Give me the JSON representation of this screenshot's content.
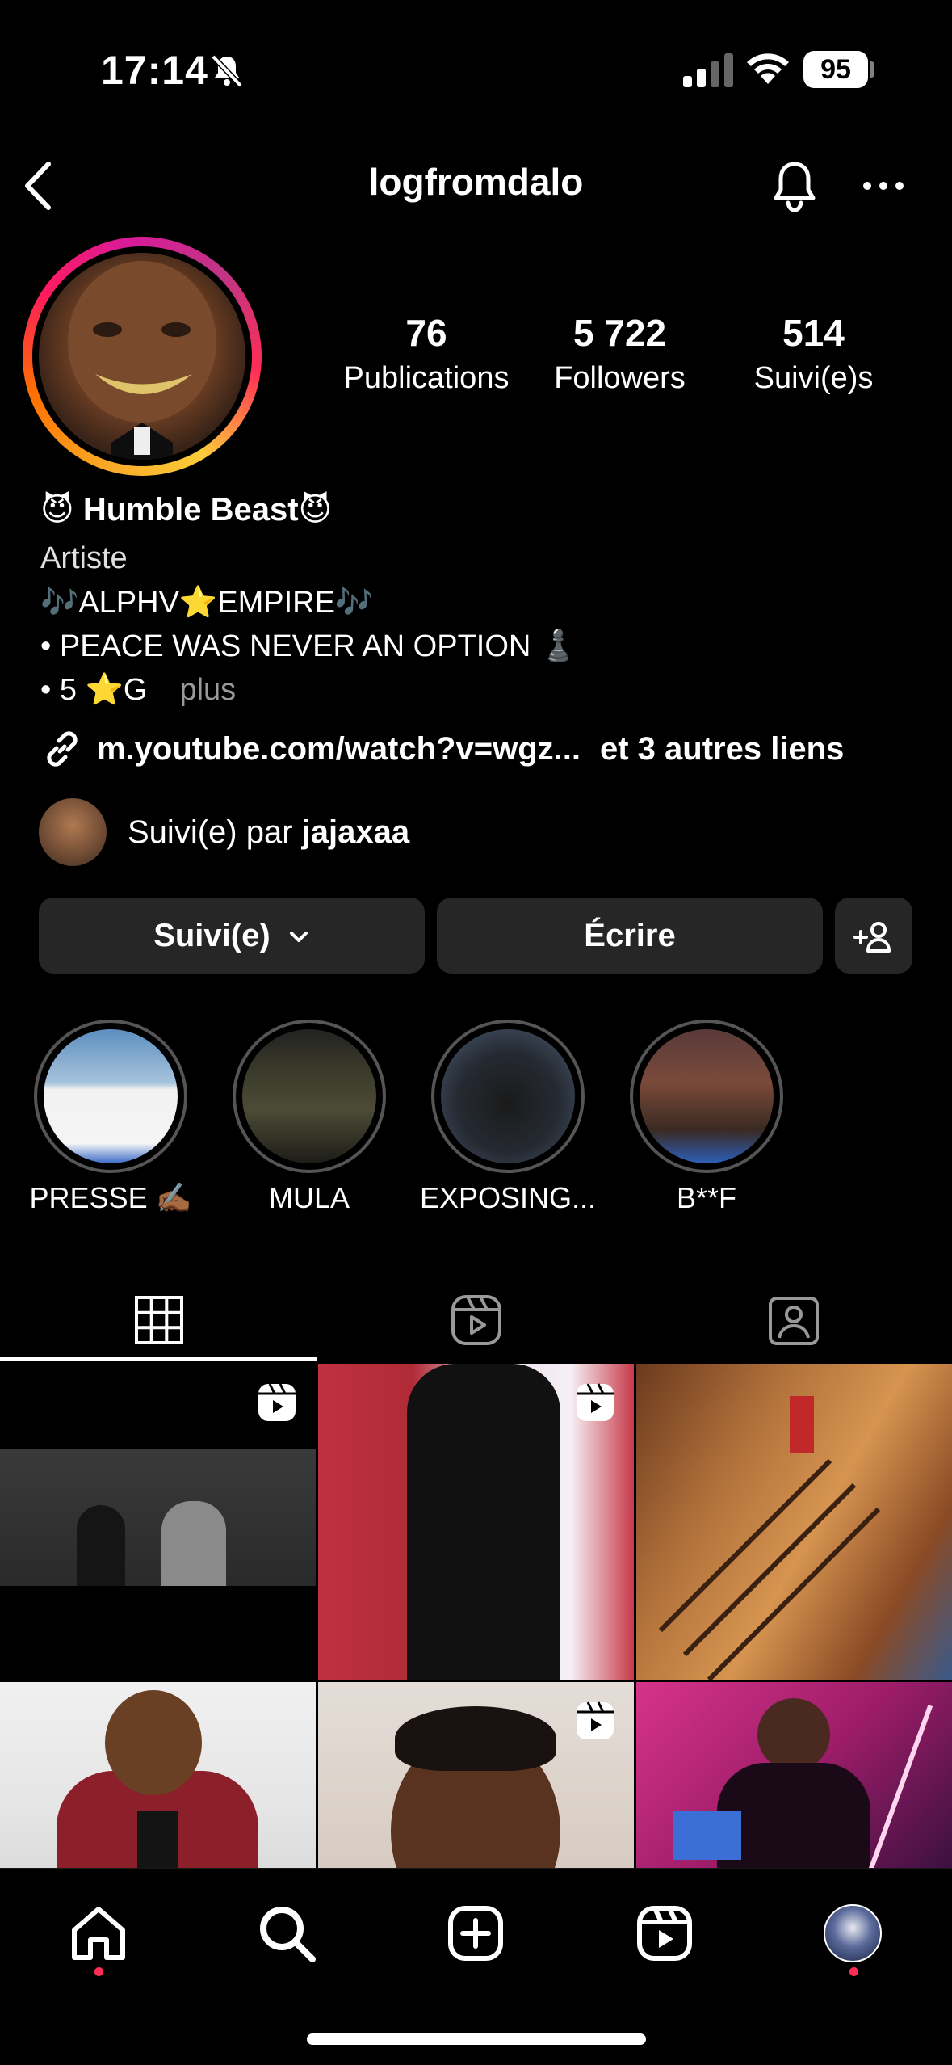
{
  "status_bar": {
    "time": "17:14",
    "battery": "95"
  },
  "header": {
    "username": "logfromdalo"
  },
  "stats": [
    {
      "value": "76",
      "label": "Publications"
    },
    {
      "value": "5 722",
      "label": "Followers"
    },
    {
      "value": "514",
      "label": "Suivi(e)s"
    }
  ],
  "bio": {
    "name": "😈 Humble Beast😈",
    "category": "Artiste",
    "lines": [
      "🎶ALPHV⭐️EMPIRE🎶",
      "• PEACE WAS NEVER AN OPTION ♟️",
      "• 5 ⭐️G"
    ],
    "more": "plus",
    "link": "m.youtube.com/watch?v=wgz...",
    "link_extra": "et 3 autres liens"
  },
  "followed_by": {
    "prefix": "Suivi(e) par ",
    "user": "jajaxaa"
  },
  "buttons": {
    "following": "Suivi(e)",
    "message": "Écrire"
  },
  "highlights": [
    {
      "label": "PRESSE ✍🏾"
    },
    {
      "label": "MULA"
    },
    {
      "label": "EXPOSING..."
    },
    {
      "label": "B**F"
    }
  ],
  "tabs": [
    {
      "icon": "grid-icon"
    },
    {
      "icon": "reels-icon"
    },
    {
      "icon": "tagged-icon"
    }
  ],
  "posts": [
    {
      "type": "reel"
    },
    {
      "type": "reel"
    },
    {
      "type": "photo"
    },
    {
      "type": "photo"
    },
    {
      "type": "reel"
    },
    {
      "type": "photo"
    }
  ],
  "nav": [
    "home-icon",
    "search-icon",
    "create-icon",
    "reels-icon",
    "profile-icon"
  ],
  "colors": {
    "accent_red": "#ff2d55",
    "button_bg": "#262626"
  }
}
